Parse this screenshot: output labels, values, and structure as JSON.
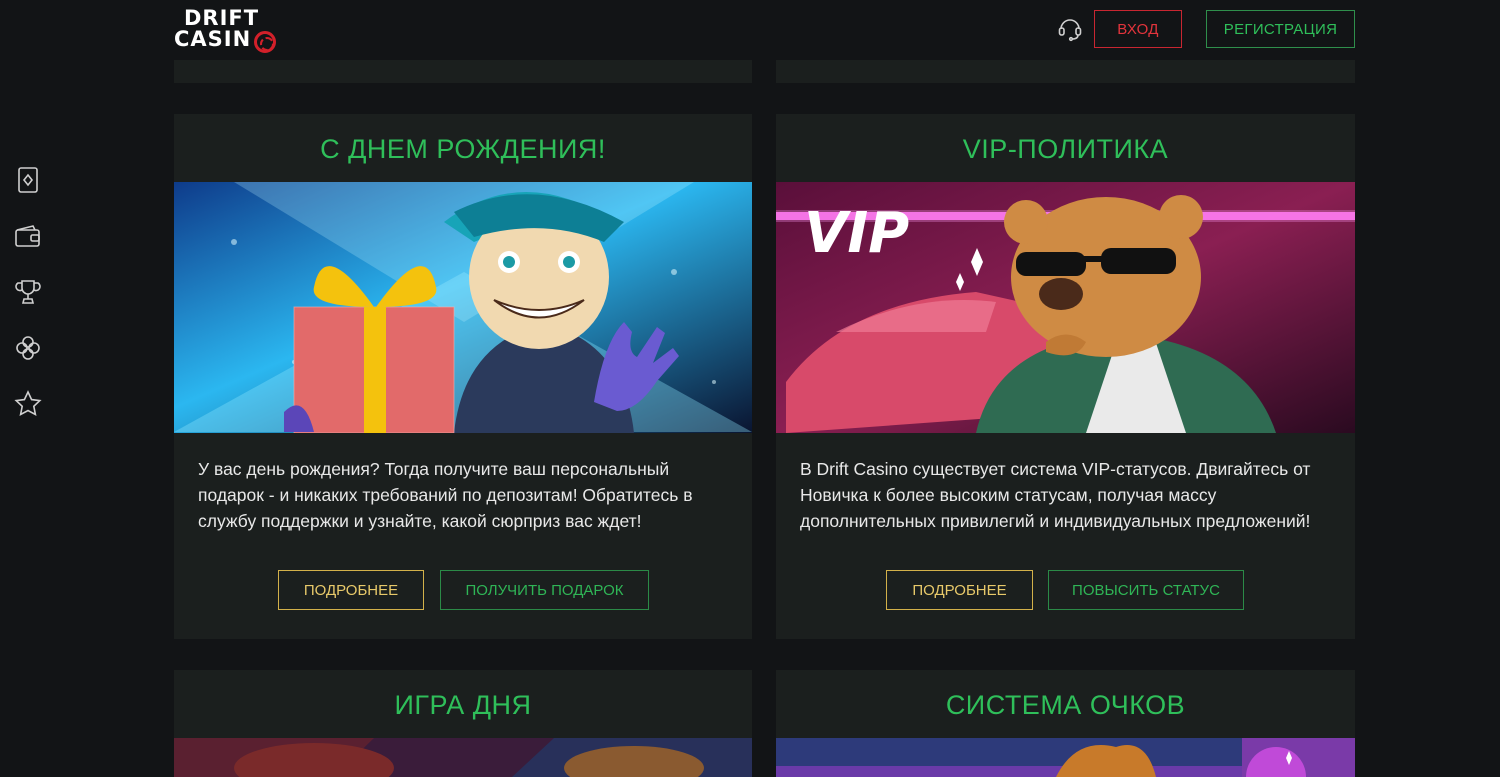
{
  "header": {
    "logo_line1": "DRIFT",
    "logo_line2": "CASIN",
    "support_icon": "headset-icon",
    "login_label": "ВХОД",
    "register_label": "РЕГИСТРАЦИЯ"
  },
  "sidebar": {
    "items": [
      {
        "icon": "cards-icon"
      },
      {
        "icon": "wallet-icon"
      },
      {
        "icon": "trophy-icon"
      },
      {
        "icon": "clover-icon"
      },
      {
        "icon": "star-icon"
      }
    ]
  },
  "cards": {
    "birthday": {
      "title": "С ДНЕМ РОЖДЕНИЯ!",
      "text": "У вас день рождения? Тогда получите ваш персональный подарок - и никаких требований по депозитам! Обратитесь в службу поддержки и узнайте, какой сюрприз вас ждет!",
      "more_label": "ПОДРОБНЕЕ",
      "action_label": "ПОЛУЧИТЬ ПОДАРОК"
    },
    "vip": {
      "title": "VIP-ПОЛИТИКА",
      "image_text": "VIP",
      "text": "В Drift Casino существует система VIP-статусов. Двигайтесь от Новичка к более высоким статусам, получая массу дополнительных привилегий и индивидуальных предложений!",
      "more_label": "ПОДРОБНЕЕ",
      "action_label": "ПОВЫСИТЬ СТАТУС"
    },
    "game_of_day": {
      "title": "ИГРА ДНЯ"
    },
    "points": {
      "title": "СИСТЕМА ОЧКОВ"
    }
  },
  "colors": {
    "background": "#121416",
    "card": "#1b1f1e",
    "accent_green": "#2fbf5a",
    "accent_red": "#c82631",
    "accent_gold": "#d3b14a"
  }
}
